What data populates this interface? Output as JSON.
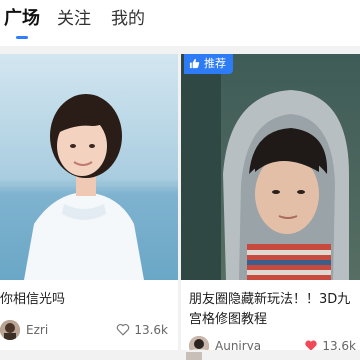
{
  "tabs": [
    {
      "label": "广场",
      "active": true
    },
    {
      "label": "关注",
      "active": false
    },
    {
      "label": "我的",
      "active": false
    }
  ],
  "accent_color": "#2f80ff",
  "feed": [
    {
      "caption": "你相信光吗",
      "author": "Ezri",
      "likes": "13.6k",
      "liked": false
    },
    {
      "badge": "推荐",
      "badge_icon": "thumbs-up-icon",
      "caption": "朋友圈隐藏新玩法！！3D九宫格修图教程",
      "author": "Aunirya",
      "likes": "13.6k",
      "liked": true,
      "liked_color": "#f04a58"
    }
  ]
}
